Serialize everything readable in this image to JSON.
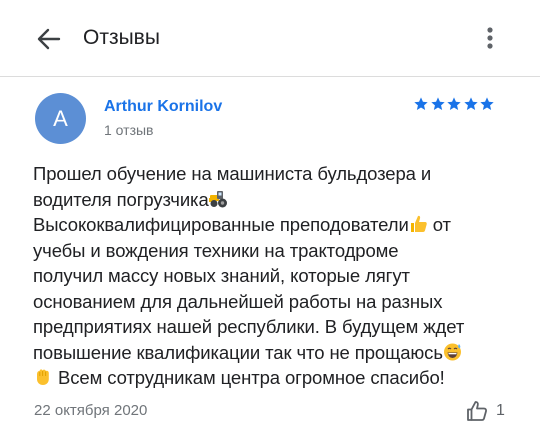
{
  "header": {
    "title": "Отзывы",
    "back_icon": "arrow-left-icon",
    "menu_icon": "more-vert-icon"
  },
  "review": {
    "avatar_letter": "A",
    "avatar_color": "#5c8fd5",
    "author": "Arthur Kornilov",
    "reviews_count": "1 отзыв",
    "rating": 5,
    "rating_max": 5,
    "star_color": "#1a73e8",
    "lines": [
      "Прошел обучение на машиниста бульдозера и",
      "водителя погрузчика",
      "Высококвалифицированные преподователи",
      "учебы и вождения техники на трактодроме",
      "получил массу новых знаний, которые лягут",
      "основанием для дальнейшей работы на разных",
      "предприятиях нашей республики. В будущем ждет",
      "повышение квалификации так что не прощаюсь",
      "Всем сотрудникам центра огромное спасибо!"
    ],
    "line3_tail": " от",
    "emoji": {
      "tractor": "tractor-emoji",
      "thumbs_up": "thumbs-up-emoji",
      "grin_sweat": "grinning-sweat-emoji",
      "raised_fist": "raised-fist-emoji"
    },
    "date": "22 октября 2020",
    "likes": "1",
    "like_icon": "thumb-up-outline-icon"
  }
}
